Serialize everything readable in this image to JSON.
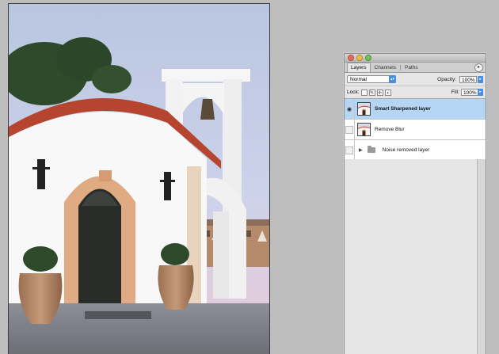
{
  "panel": {
    "tabs": [
      {
        "label": "Layers"
      },
      {
        "label": "Channels"
      },
      {
        "label": "Paths"
      }
    ],
    "blend_mode": "Normal",
    "opacity_label": "Opacity:",
    "opacity_value": "100%",
    "lock_label": "Lock:",
    "fill_label": "Fill:",
    "fill_value": "100%",
    "layers": [
      {
        "name": "Smart Sharpened layer",
        "visible": true,
        "selected": true
      },
      {
        "name": "Remove Blur",
        "visible": false,
        "selected": false
      },
      {
        "name": "Noise removed layer",
        "visible": false,
        "selected": false,
        "group": true
      }
    ]
  },
  "colors": {
    "selection": "#b5d5f5",
    "accent_blue": "#4a8fdc",
    "workspace": "#bdbdbd"
  },
  "icons": [
    "eye-icon",
    "folder-icon",
    "disclosure-triangle-icon",
    "panel-menu-icon",
    "lock-icon"
  ]
}
